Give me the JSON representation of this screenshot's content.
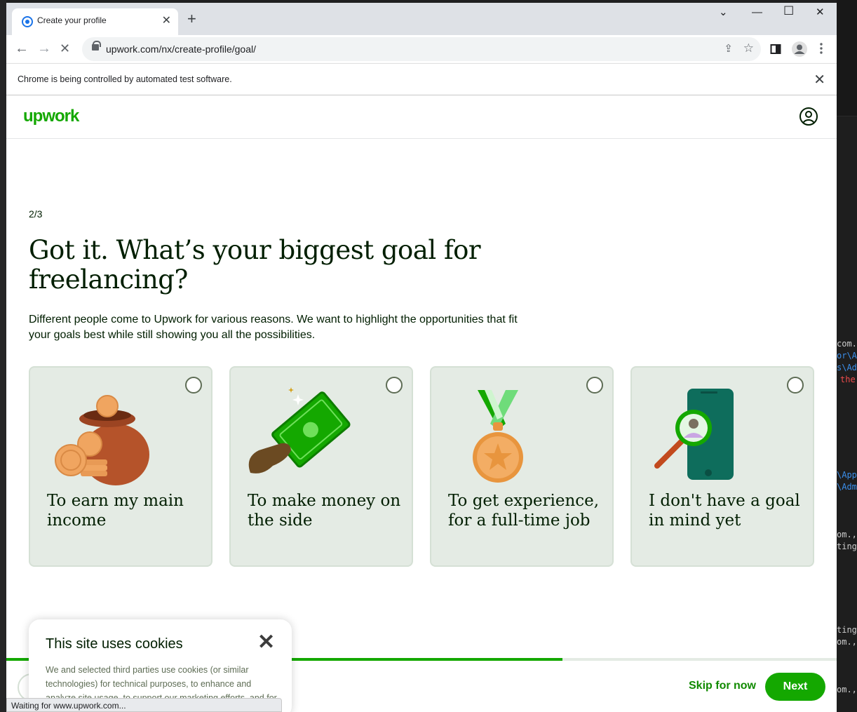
{
  "browser": {
    "tab_title": "Create your profile",
    "url": "upwork.com/nx/create-profile/goal/",
    "infobar_message": "Chrome is being controlled by automated test software.",
    "status_text": "Waiting for www.upwork.com..."
  },
  "header": {
    "logo": "upwork"
  },
  "main": {
    "step": "2/3",
    "heading": "Got it. What’s your biggest goal for freelancing?",
    "description": "Different people come to Upwork for various reasons. We want to highlight the opportunities that fit your goals best while still showing you all the possibilities.",
    "options": [
      {
        "label": "To earn my main income",
        "icon": "money-bag-icon"
      },
      {
        "label": "To make money on the side",
        "icon": "cash-in-hand-icon"
      },
      {
        "label": "To get experience, for a full-time job",
        "icon": "medal-icon"
      },
      {
        "label": "I don't have a goal in mind yet",
        "icon": "phone-search-icon"
      }
    ],
    "progress_fraction": 0.67
  },
  "footer": {
    "skip_label": "Skip for now",
    "next_label": "Next"
  },
  "cookie": {
    "title": "This site uses cookies",
    "text": "We and selected third parties use cookies (or similar technologies) for technical purposes, to enhance and analyze site usage, to support our marketing efforts, and for"
  },
  "terminal": {
    "lines": [
      "com.,",
      "or\\Ap",
      "s\\Adm",
      "the",
      "\\App",
      "\\Adm",
      "om.,",
      "ting",
      "ting",
      "om.,",
      "om.,"
    ]
  },
  "colors": {
    "brand_green": "#14a800",
    "card_bg": "#e4ebe4",
    "text_dark": "#001e00"
  }
}
